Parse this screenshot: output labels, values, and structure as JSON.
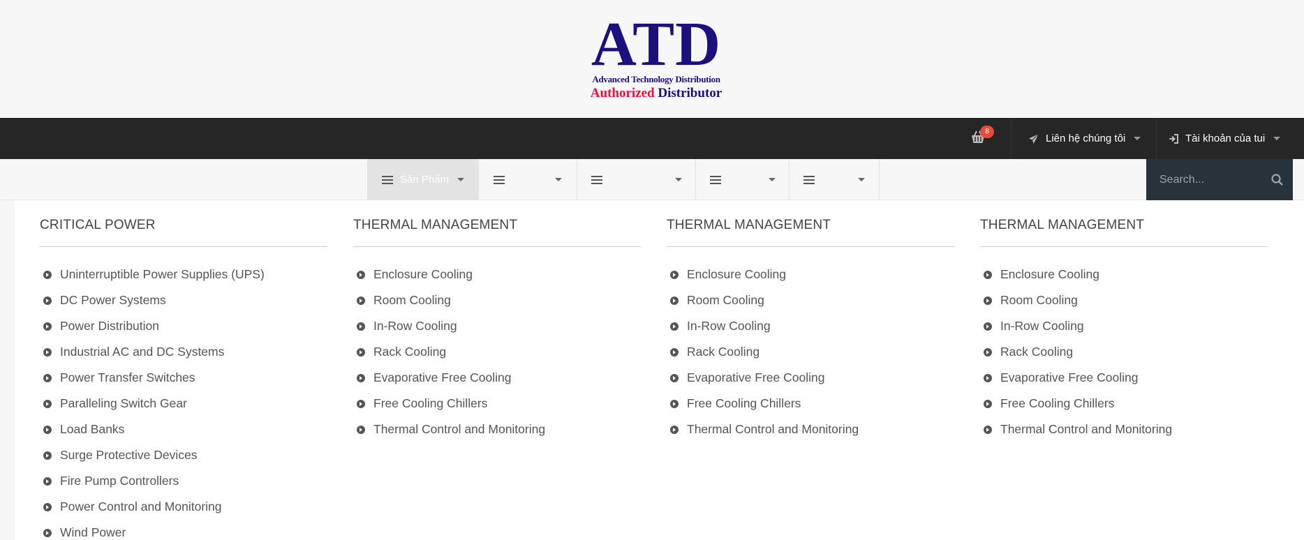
{
  "logo": {
    "main": "ATD",
    "sub": "Advanced Technology Distribution",
    "auth_red": "Authorized",
    "auth_navy": "Distributor"
  },
  "topbar": {
    "cart_count": "8",
    "contact_label": "Liên hệ chúng tôi",
    "account_label": "Tài khoản của tui"
  },
  "nav": {
    "items": [
      {
        "label": "Sản Phẩm"
      },
      {
        "label": ""
      },
      {
        "label": ""
      },
      {
        "label": ""
      },
      {
        "label": ""
      }
    ]
  },
  "search": {
    "placeholder": "Search..."
  },
  "mega_menu": {
    "columns": [
      {
        "title": "CRITICAL POWER",
        "items": [
          "Uninterruptible Power Supplies (UPS)",
          "DC Power Systems",
          "Power Distribution",
          "Industrial AC and DC Systems",
          "Power Transfer Switches",
          "Paralleling Switch Gear",
          "Load Banks",
          "Surge Protective Devices",
          "Fire Pump Controllers",
          "Power Control and Monitoring",
          "Wind Power"
        ]
      },
      {
        "title": "THERMAL MANAGEMENT",
        "items": [
          "Enclosure Cooling",
          "Room Cooling",
          "In-Row Cooling",
          "Rack Cooling",
          "Evaporative Free Cooling",
          "Free Cooling Chillers",
          "Thermal Control and Monitoring"
        ]
      },
      {
        "title": "THERMAL MANAGEMENT",
        "items": [
          "Enclosure Cooling",
          "Room Cooling",
          "In-Row Cooling",
          "Rack Cooling",
          "Evaporative Free Cooling",
          "Free Cooling Chillers",
          "Thermal Control and Monitoring"
        ]
      },
      {
        "title": "THERMAL MANAGEMENT",
        "items": [
          "Enclosure Cooling",
          "Room Cooling",
          "In-Row Cooling",
          "Rack Cooling",
          "Evaporative Free Cooling",
          "Free Cooling Chillers",
          "Thermal Control and Monitoring"
        ]
      }
    ]
  }
}
